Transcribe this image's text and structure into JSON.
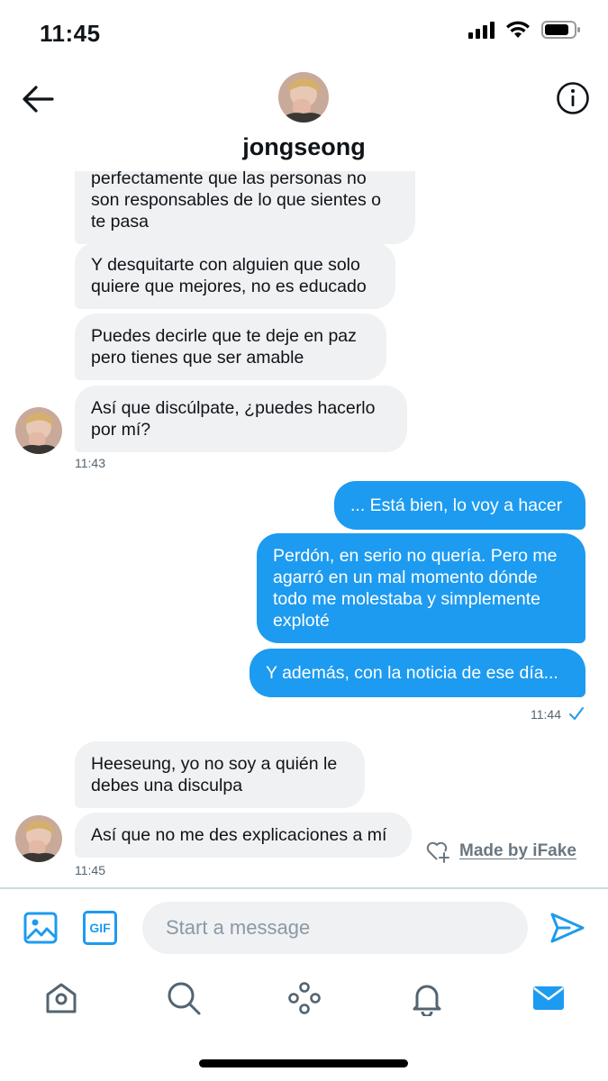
{
  "status_bar": {
    "time": "11:45"
  },
  "header": {
    "name": "jongseong",
    "avatar_icon": "user-avatar"
  },
  "messages": {
    "in1": "perfectamente que las personas no son responsables de lo que sientes o te pasa",
    "in2": "Y desquitarte con alguien que solo quiere que mejores, no es educado",
    "in3": "Puedes decirle que te deje en paz pero tienes que ser amable",
    "in4": "Así que discúlpate, ¿puedes hacerlo por mí?",
    "ts1": "11:43",
    "out1": "... Está bien, lo voy a hacer",
    "out2": "Perdón, en serio no quería. Pero me agarró en un mal momento dónde todo me molestaba y simplemente exploté",
    "out3": "Y además, con la noticia de ese día...",
    "ts2": "11:44",
    "in5": "Heeseung, yo no soy a quién le debes una disculpa",
    "in6": "Así que no me des explicaciones a mí",
    "ts3": "11:45"
  },
  "watermark": {
    "label": "Made by iFake"
  },
  "composer": {
    "placeholder": "Start a message",
    "gif_label": "GIF"
  },
  "colors": {
    "accent": "#1d9bf0",
    "incoming_bg": "#eff1f3",
    "tab_icon": "#536471"
  },
  "tabs": [
    "home-icon",
    "search-icon",
    "spaces-icon",
    "notifications-icon",
    "messages-icon"
  ]
}
